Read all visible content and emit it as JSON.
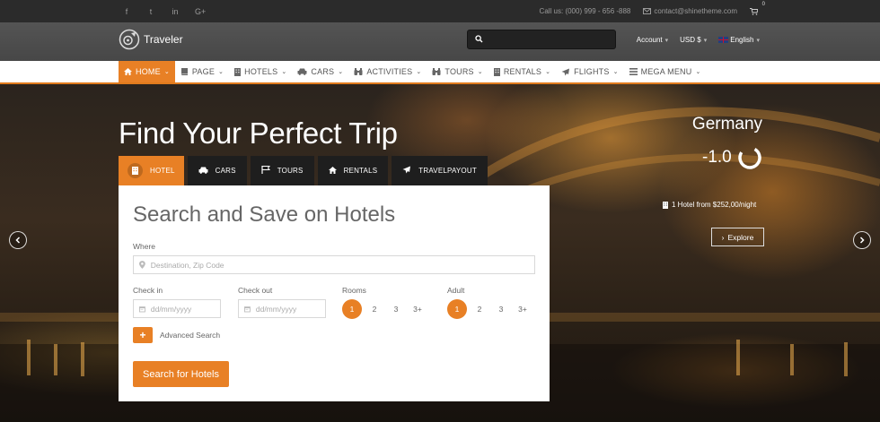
{
  "topbar": {
    "social": [
      "f",
      "t",
      "in",
      "G+"
    ],
    "phone": "Call us: (000) 999 - 656 -888",
    "email": "contact@shinetheme.com",
    "cart_count": "0"
  },
  "header": {
    "logo_text": "Traveler",
    "search": {
      "value": "",
      "placeholder": ""
    },
    "account": "Account",
    "currency": "USD $",
    "language": "English"
  },
  "nav": {
    "items": [
      {
        "label": "HOME",
        "icon": "home-icon"
      },
      {
        "label": "PAGE",
        "icon": "book-icon"
      },
      {
        "label": "HOTELS",
        "icon": "building-icon"
      },
      {
        "label": "CARS",
        "icon": "car-icon"
      },
      {
        "label": "ACTIVITIES",
        "icon": "binoculars-icon"
      },
      {
        "label": "TOURS",
        "icon": "binoculars-icon"
      },
      {
        "label": "RENTALS",
        "icon": "building-icon"
      },
      {
        "label": "FLIGHTS",
        "icon": "plane-icon"
      },
      {
        "label": "MEGA MENU",
        "icon": "list-icon"
      }
    ]
  },
  "hero": {
    "title": "Find Your Perfect Trip",
    "location": "Germany",
    "rating": "-1.0",
    "hotel_from": "1 Hotel from $252,00/night",
    "explore": "Explore"
  },
  "tabs": [
    {
      "label": "HOTEL",
      "icon": "building-icon"
    },
    {
      "label": "CARS",
      "icon": "car-icon"
    },
    {
      "label": "TOURS",
      "icon": "flag-icon"
    },
    {
      "label": "RENTALS",
      "icon": "home-icon"
    },
    {
      "label": "TRAVELPAYOUT",
      "icon": "plane-icon"
    }
  ],
  "form": {
    "title": "Search and Save on Hotels",
    "where_label": "Where",
    "where_placeholder": "Destination, Zip Code",
    "checkin_label": "Check in",
    "checkin_placeholder": "dd/mm/yyyy",
    "checkout_label": "Check out",
    "checkout_placeholder": "dd/mm/yyyy",
    "rooms_label": "Rooms",
    "rooms_options": [
      "1",
      "2",
      "3",
      "3+"
    ],
    "adult_label": "Adult",
    "adult_options": [
      "1",
      "2",
      "3",
      "3+"
    ],
    "advanced": "Advanced Search",
    "submit": "Search for Hotels"
  },
  "colors": {
    "accent": "#e88025",
    "topbar": "#2b2b2b",
    "header": "#4e4e4e"
  }
}
